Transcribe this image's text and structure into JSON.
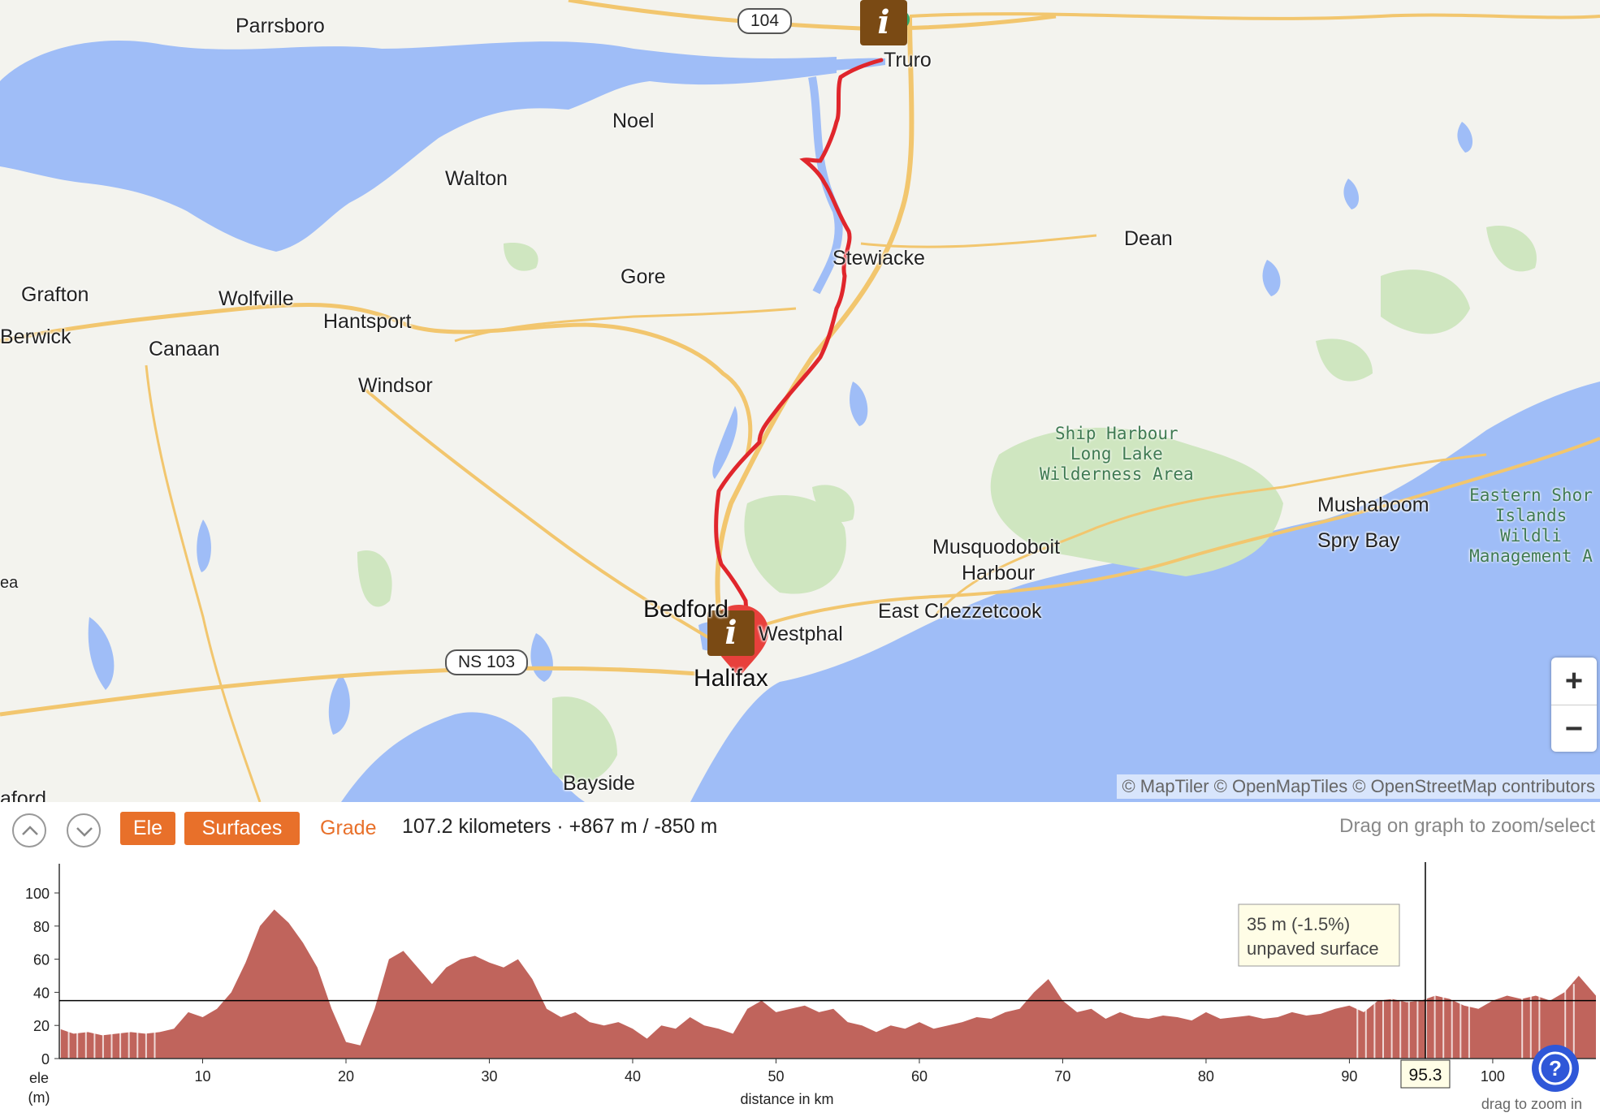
{
  "map": {
    "places": [
      {
        "name": "Parrsboro",
        "big": false
      },
      {
        "name": "Truro",
        "big": false
      },
      {
        "name": "Noel",
        "big": false
      },
      {
        "name": "Walton",
        "big": false
      },
      {
        "name": "Dean",
        "big": false
      },
      {
        "name": "Stewiacke",
        "big": false
      },
      {
        "name": "Gore",
        "big": false
      },
      {
        "name": "Grafton",
        "big": false
      },
      {
        "name": "Wolfville",
        "big": false
      },
      {
        "name": "Hantsport",
        "big": false
      },
      {
        "name": "Berwick",
        "big": false
      },
      {
        "name": "Canaan",
        "big": false
      },
      {
        "name": "Windsor",
        "big": false
      },
      {
        "name": "Mushaboom",
        "big": false
      },
      {
        "name": "Spry Bay",
        "big": false
      },
      {
        "name": "Musquodoboit",
        "big": false
      },
      {
        "name": "Harbour",
        "big": false
      },
      {
        "name": "East Chezzetcook",
        "big": false
      },
      {
        "name": "Bedford",
        "big": true
      },
      {
        "name": "Westphal",
        "big": false
      },
      {
        "name": "Halifax",
        "big": true
      },
      {
        "name": "Bayside",
        "big": false
      },
      {
        "name": "ea",
        "big": false
      },
      {
        "name": "aford",
        "big": false
      }
    ],
    "parks": [
      "Ship Harbour\nLong Lake\nWilderness Area",
      "Eastern Shor\nIslands Wildli\nManagement A"
    ],
    "shields": [
      "104",
      "NS 103"
    ],
    "info_marker_symbol": "i",
    "attribution": "© MapTiler © OpenMapTiles © OpenStreetMap contributors",
    "zoom_in_label": "+",
    "zoom_out_label": "−",
    "route_color": "#e0262c",
    "water_color": "#9fbdf7",
    "land_color": "#f3f3ee",
    "forest_color": "#cfe6c0",
    "road_color": "#f2c66e"
  },
  "toolbar": {
    "collapse_icon": "chevron-up-icon",
    "expand_icon": "chevron-down-icon",
    "ele_label": "Ele",
    "surfaces_label": "Surfaces",
    "grade_label": "Grade",
    "summary": "107.2 kilometers · +867 m / -850 m",
    "hint": "Drag on graph to zoom/select",
    "accent_color": "#e8702a"
  },
  "chart_data": {
    "type": "area",
    "xlabel": "distance in km",
    "ylabel": "ele\n(m)",
    "xlim": [
      0,
      107.2
    ],
    "ylim": [
      0,
      100
    ],
    "xticks": [
      10,
      20,
      30,
      40,
      50,
      60,
      70,
      80,
      90,
      100
    ],
    "yticks": [
      0,
      20,
      40,
      60,
      80,
      100
    ],
    "fill_color": "#c0645c",
    "x": [
      0,
      1,
      2,
      3,
      4,
      5,
      6,
      7,
      8,
      9,
      10,
      11,
      12,
      13,
      14,
      15,
      16,
      17,
      18,
      19,
      20,
      21,
      22,
      23,
      24,
      25,
      26,
      27,
      28,
      29,
      30,
      31,
      32,
      33,
      34,
      35,
      36,
      37,
      38,
      39,
      40,
      41,
      42,
      43,
      44,
      45,
      46,
      47,
      48,
      49,
      50,
      51,
      52,
      53,
      54,
      55,
      56,
      57,
      58,
      59,
      60,
      61,
      62,
      63,
      64,
      65,
      66,
      67,
      68,
      69,
      70,
      71,
      72,
      73,
      74,
      75,
      76,
      77,
      78,
      79,
      80,
      81,
      82,
      83,
      84,
      85,
      86,
      87,
      88,
      89,
      90,
      91,
      92,
      93,
      94,
      95,
      96,
      97,
      98,
      99,
      100,
      101,
      102,
      103,
      104,
      105,
      106,
      107.2
    ],
    "y": [
      18,
      15,
      16,
      14,
      15,
      16,
      15,
      16,
      18,
      28,
      25,
      30,
      40,
      58,
      80,
      90,
      82,
      70,
      55,
      30,
      10,
      8,
      30,
      60,
      65,
      55,
      45,
      55,
      60,
      62,
      58,
      55,
      60,
      48,
      30,
      25,
      28,
      22,
      20,
      22,
      18,
      12,
      20,
      18,
      25,
      20,
      18,
      15,
      30,
      35,
      28,
      30,
      32,
      28,
      30,
      22,
      20,
      16,
      20,
      18,
      22,
      18,
      20,
      22,
      25,
      24,
      28,
      30,
      40,
      48,
      35,
      28,
      30,
      24,
      28,
      25,
      24,
      26,
      25,
      23,
      28,
      24,
      25,
      26,
      24,
      25,
      28,
      26,
      27,
      30,
      32,
      28,
      35,
      36,
      34,
      35,
      38,
      36,
      32,
      30,
      35,
      38,
      36,
      38,
      35,
      40,
      50,
      38
    ],
    "unpaved_ranges": [
      [
        0,
        7
      ],
      [
        90.5,
        98.5
      ],
      [
        102,
        103.5
      ],
      [
        105,
        106
      ]
    ],
    "cursor": {
      "x": 95.3,
      "x_label": "95.3",
      "y": 35,
      "tooltip_line1": "35 m (-1.5%)",
      "tooltip_line2": "unpaved surface"
    },
    "corner_hint": "drag to zoom in"
  },
  "help_icon": "question-icon"
}
